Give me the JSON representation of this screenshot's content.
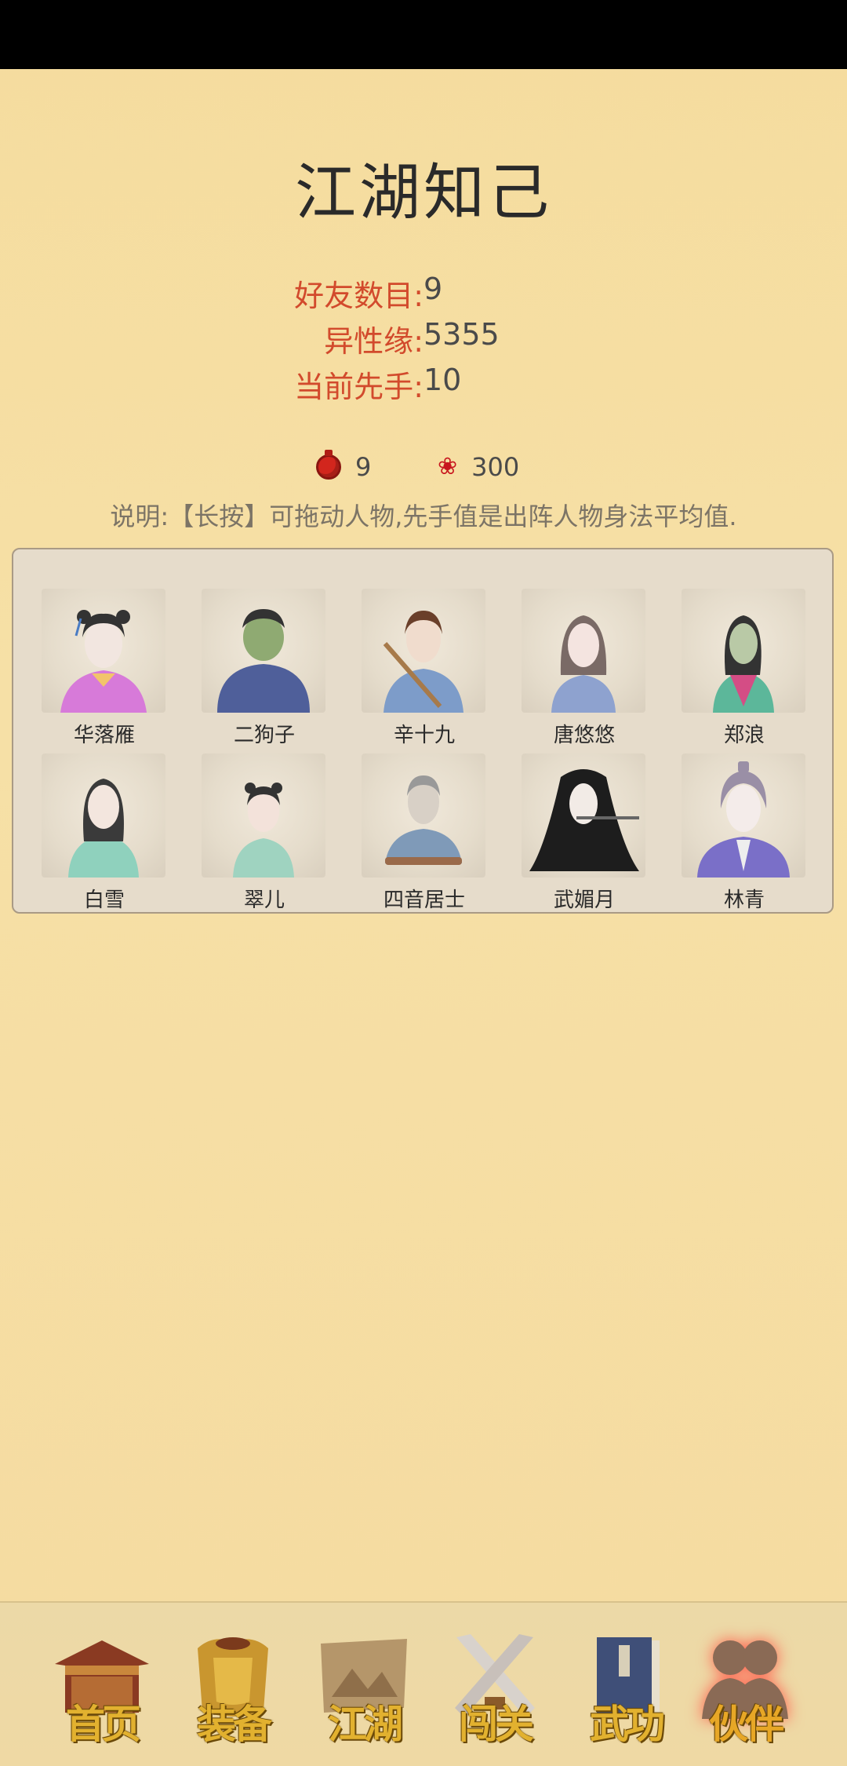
{
  "page": {
    "title": "江湖知己"
  },
  "stats": [
    {
      "label": "好友数目",
      "value": "9"
    },
    {
      "label": "异性缘",
      "value": "5355"
    },
    {
      "label": "当前先手",
      "value": "10"
    }
  ],
  "currency": {
    "potion": {
      "icon": "red-potion-icon",
      "value": "9"
    },
    "rose": {
      "icon": "rose-icon",
      "value": "300"
    }
  },
  "note": "说明:【长按】可拖动人物,先手值是出阵人物身法平均值.",
  "characters": [
    {
      "name": "华落雁"
    },
    {
      "name": "二狗子"
    },
    {
      "name": "辛十九"
    },
    {
      "name": "唐悠悠"
    },
    {
      "name": "郑浪"
    },
    {
      "name": "白雪"
    },
    {
      "name": "翠儿"
    },
    {
      "name": "四音居士"
    },
    {
      "name": "武媚月"
    },
    {
      "name": "林青"
    }
  ],
  "nav": [
    {
      "label": "首页",
      "icon": "house-icon"
    },
    {
      "label": "装备",
      "icon": "armor-icon"
    },
    {
      "label": "江湖",
      "icon": "map-scroll-icon"
    },
    {
      "label": "闯关",
      "icon": "crossed-swords-icon"
    },
    {
      "label": "武功",
      "icon": "book-icon"
    },
    {
      "label": "伙伴",
      "icon": "companions-icon",
      "active": true
    }
  ]
}
